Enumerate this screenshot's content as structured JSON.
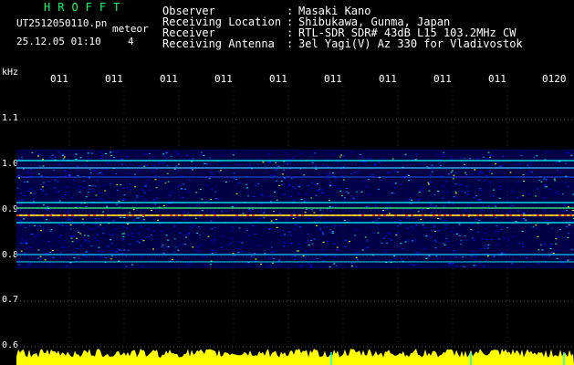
{
  "header": {
    "app_title": "HROFFT",
    "file_name": "UT2512050110.pn",
    "meteor_label": "meteor",
    "datetime": "25.12.05 01:10",
    "count": "4"
  },
  "info": [
    {
      "label": "Observer",
      "sep": ":",
      "value": "Masaki Kano"
    },
    {
      "label": "Receiving Location",
      "sep": ":",
      "value": "Shibukawa, Gunma, Japan"
    },
    {
      "label": "Receiver",
      "sep": ":",
      "value": "RTL-SDR SDR# 43dB L15 103.2MHz CW"
    },
    {
      "label": "Receiving Antenna",
      "sep": ":",
      "value": "3el Yagi(V) Az 330 for Vladivostok"
    }
  ],
  "axis": {
    "unit": "kHz",
    "y_ticks": [
      "1.1",
      "1.0",
      "0.9",
      "0.8",
      "0.7",
      "0.6"
    ],
    "time_labels": [
      "011",
      "011",
      "011",
      "011",
      "011",
      "011",
      "011",
      "011",
      "011",
      "0120"
    ]
  },
  "colors": {
    "background": "#000000",
    "title": "#00ff66",
    "waterfall_base": "#000080",
    "signal_strong": "#ff3030",
    "amplitude": "#ffff00",
    "marker": "#00ffff"
  }
}
